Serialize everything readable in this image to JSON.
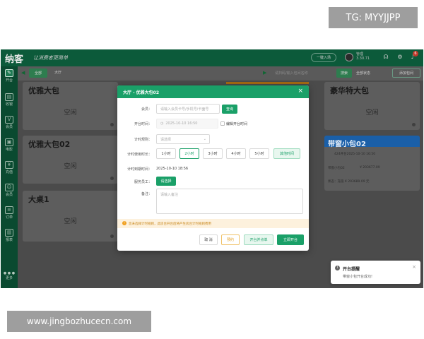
{
  "watermarks": {
    "top": "TG: MYYJJPP",
    "bottom": "www.jingbozhucecn.com"
  },
  "header": {
    "logo": "纳客",
    "brand": "让消费者更简单",
    "action_button": "一键入场",
    "user_name": "管理",
    "user_id": "3.30.71",
    "notification_count": "6"
  },
  "sidebar": {
    "items": [
      {
        "label": "开台",
        "icon": "cashier-icon"
      },
      {
        "label": "收银",
        "icon": "receipt-icon"
      },
      {
        "label": "会员",
        "icon": "vip-icon"
      },
      {
        "label": "电影",
        "icon": "film-icon"
      },
      {
        "label": "充值",
        "icon": "recharge-icon"
      },
      {
        "label": "会员",
        "icon": "member-icon"
      },
      {
        "label": "订单",
        "icon": "order-icon"
      },
      {
        "label": "报表",
        "icon": "report-icon"
      }
    ],
    "more": "更多"
  },
  "toolbar": {
    "tab_all": "全部",
    "tab_hall": "大厅",
    "search_placeholder": "请扫码/输入包间名称",
    "search_button": "搜索",
    "status_filter": "全部状态",
    "add_room": "添加包间"
  },
  "rooms": [
    {
      "name": "优雅大包",
      "status": "空闲"
    },
    {
      "name": "优雅大包02",
      "status": "空闲"
    },
    {
      "name": "大桌1",
      "status": "空闲"
    },
    {
      "name": "豪华特大包",
      "status": "空闲"
    },
    {
      "name": "带窗小包02",
      "line1": "424开台2025-10-10 16:50",
      "line2": "带窗小包02",
      "line3": "¥ 203677.09",
      "line4": "状态：充值 ¥ 203689.09 元"
    }
  ],
  "modal": {
    "title": "大厅 - 优雅大包02",
    "close": "×",
    "member_label": "会员：",
    "member_placeholder": "请输入会员卡号/手机号/卡面号",
    "query_button": "查询",
    "start_time_label": "开台时间：",
    "start_time_value": "2025-10-10 16:50",
    "edit_start_time": "编辑开台时间",
    "rule_label": "计时规则：",
    "rule_placeholder": "请选择",
    "duration_label": "计时使用时长：",
    "durations": [
      "1小时",
      "2小时",
      "3小时",
      "4小时",
      "5小时"
    ],
    "other_time": "其他时间",
    "end_time_label": "计时到期时间：",
    "end_time_value": "2025-10-10 18:56",
    "staff_label": "服务员工：",
    "staff_button": "请选择",
    "remark_label": "备注：",
    "remark_placeholder": "请输入备注",
    "notice": "您未选择计时规则，此房台开台后将产生房台计时规则费用",
    "cancel": "取 消",
    "reserve": "预约",
    "open_and_order": "开台并点单",
    "open_now": "立即开台"
  },
  "toast": {
    "title": "开台提醒",
    "message": "带窗小包开台成功!",
    "close": "×"
  },
  "colors": {
    "primary": "#1aa068",
    "header_bg": "#0c5a3a",
    "busy_blue": "#1a5fa8",
    "warning": "#f0a020"
  }
}
